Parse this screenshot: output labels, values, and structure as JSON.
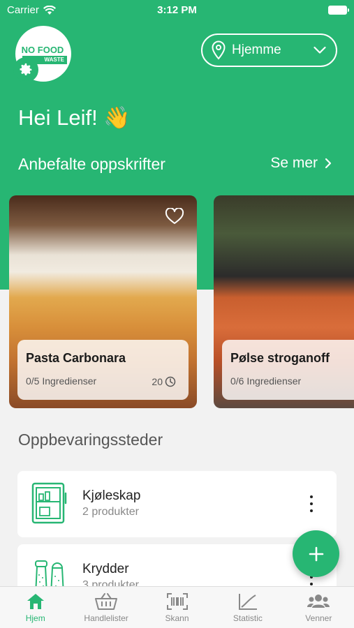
{
  "status_bar": {
    "carrier": "Carrier",
    "time": "3:12 PM"
  },
  "header": {
    "logo_text": "NO FOOD",
    "logo_subtext": "WASTE",
    "location_label": "Hjemme",
    "greeting": "Hei Leif! 👋"
  },
  "recipes": {
    "title": "Anbefalte oppskrifter",
    "see_more": "Se mer",
    "items": [
      {
        "name": "Pasta Carbonara",
        "ingredients": "0/5 Ingredienser",
        "time": "20"
      },
      {
        "name": "Pølse stroganoff",
        "ingredients": "0/6 Ingredienser"
      }
    ]
  },
  "storage": {
    "title": "Oppbevaringssteder",
    "items": [
      {
        "name": "Kjøleskap",
        "count": "2 produkter",
        "icon": "fridge-icon"
      },
      {
        "name": "Krydder",
        "count": "3 produkter",
        "icon": "spice-icon"
      }
    ]
  },
  "tabbar": {
    "tabs": [
      {
        "label": "Hjem",
        "icon": "home-icon",
        "active": true
      },
      {
        "label": "Handlelister",
        "icon": "basket-icon"
      },
      {
        "label": "Skann",
        "icon": "barcode-icon"
      },
      {
        "label": "Statistic",
        "icon": "chart-icon"
      },
      {
        "label": "Venner",
        "icon": "friends-icon"
      }
    ]
  },
  "colors": {
    "brand": "#27b673",
    "background": "#f2f2f2"
  }
}
